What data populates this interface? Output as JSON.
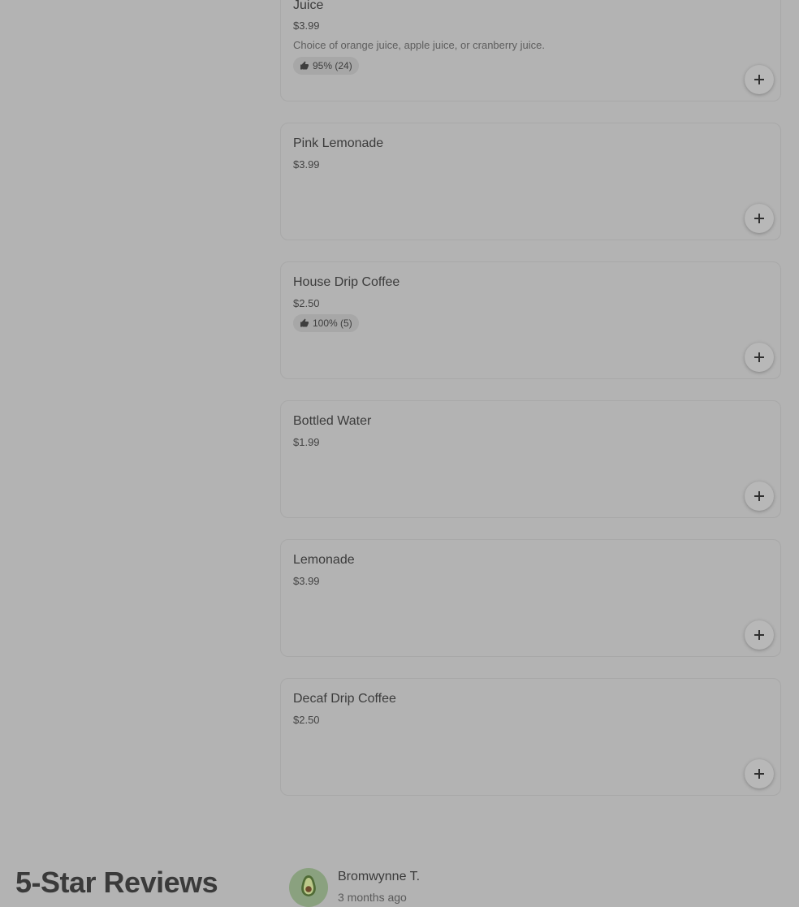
{
  "menu_items": [
    {
      "name": "Juice",
      "price": "$3.99",
      "description": "Choice of orange juice, apple juice, or cranberry juice.",
      "rating": "95% (24)"
    },
    {
      "name": "Pink Lemonade",
      "price": "$3.99"
    },
    {
      "name": "House Drip Coffee",
      "price": "$2.50",
      "rating": "100% (5)"
    },
    {
      "name": "Bottled Water",
      "price": "$1.99"
    },
    {
      "name": "Lemonade",
      "price": "$3.99"
    },
    {
      "name": "Decaf Drip Coffee",
      "price": "$2.50"
    }
  ],
  "icons": {
    "rating": "thumbs-up-icon",
    "add": "plus-icon",
    "avatar": "avocado-icon"
  },
  "reviews": {
    "heading": "5-Star Reviews",
    "items": [
      {
        "reviewer": "Bromwynne T.",
        "time": "3 months ago"
      }
    ]
  }
}
